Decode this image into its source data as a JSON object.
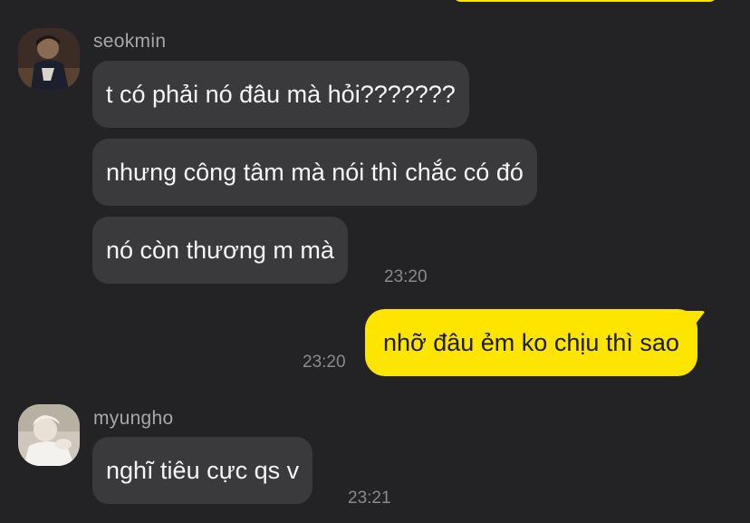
{
  "chat": {
    "groups": [
      {
        "sender": "seokmin",
        "avatar": "seokmin-avatar",
        "messages": [
          "t có phải nó đâu mà hỏi???????",
          "nhưng công tâm mà nói thì chắc có đó",
          "nó còn thương m mà"
        ],
        "time": "23:20"
      },
      {
        "sender": "me",
        "messages": [
          "nhỡ đâu ẻm ko chịu thì sao"
        ],
        "time": "23:20"
      },
      {
        "sender": "myungho",
        "avatar": "myungho-avatar",
        "messages": [
          "nghĩ tiêu cực qs v"
        ],
        "time": "23:21"
      }
    ]
  },
  "colors": {
    "background": "#232325",
    "incoming_bubble": "#3a3a3d",
    "outgoing_bubble": "#fee500",
    "sender_name": "#a7a7ab",
    "timestamp": "#8a8a8e"
  }
}
